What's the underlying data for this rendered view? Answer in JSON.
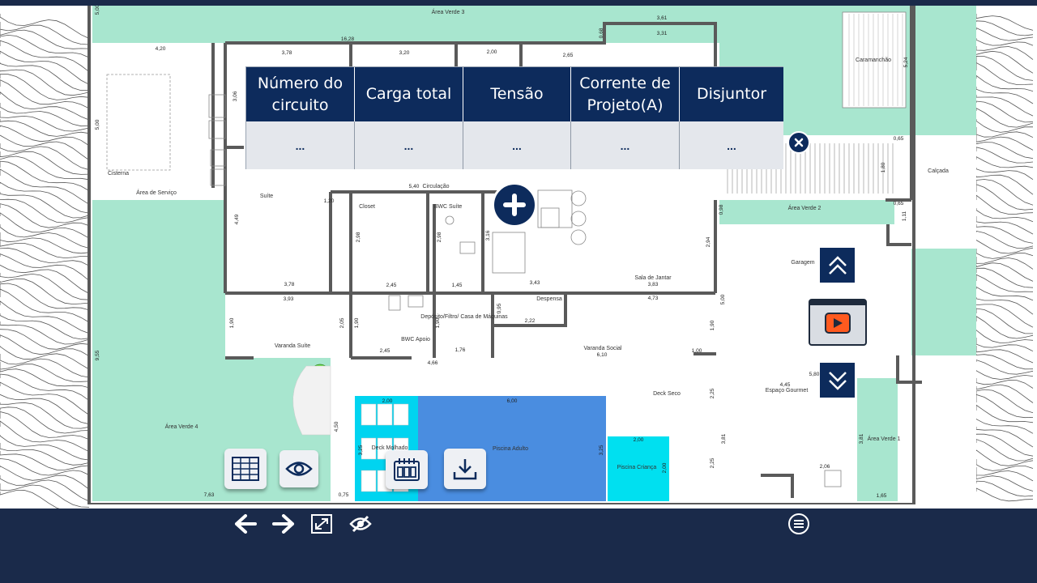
{
  "plan": {
    "rooms": {
      "area_verde_3": "Área Verde 3",
      "caramanchao": "Caramanchão",
      "cisterna": "Cisterna",
      "area_servico": "Área de Serviço",
      "suite": "Suíte",
      "circulacao": "Circulação",
      "closet": "Closet",
      "bwc_suite": "BWC Suíte",
      "calcada": "Calçada",
      "area_verde_2": "Área Verde 2",
      "garagem": "Garagem",
      "sala_jantar": "Sala de Jantar",
      "despensa": "Despensa",
      "deposito": "Depósito/Filtro/ Casa de Máquinas",
      "varanda_suite": "Varanda Suíte",
      "bwc_apoio": "BWC Apoio",
      "varanda_social": "Varanda Social",
      "deck_seco": "Deck Seco",
      "espaco_gourmet": "Espaço Gourmet",
      "area_verde_4": "Área Verde 4",
      "deck_molhado": "Deck Molhado",
      "piscina_adulto": "Piscina Adulto",
      "piscina_crianca": "Piscina Criança",
      "area_verde_1": "Área Verde 1"
    },
    "dims": {
      "d1628": "16,28",
      "d378a": "3,78",
      "d320": "3,20",
      "d200a": "2,00",
      "d265": "2,65",
      "d068": "0,68",
      "d361": "3,61",
      "d331": "3,31",
      "d420": "4,20",
      "d500a": "5,00",
      "d306": "3,06",
      "d524": "5,24",
      "d065a": "0,65",
      "d065b": "0,65",
      "d180": "1,80",
      "d111": "1,11",
      "d540": "5,40",
      "d120": "1,20",
      "d449": "4,49",
      "d298a": "2,98",
      "d298b": "2,98",
      "d316": "3,16",
      "d098": "0,98",
      "d294": "2,94",
      "d378b": "3,78",
      "d245a": "2,45",
      "d145": "1,45",
      "d343": "3,43",
      "d383": "3,83",
      "d393": "3,93",
      "d473": "4,73",
      "d095": "0,95",
      "d222": "2,22",
      "d500b": "5,00",
      "d190a": "1,90",
      "d205": "2,05",
      "d190b": "1,90",
      "d190c": "1,90",
      "d190d": "1,90",
      "d245b": "2,45",
      "d176": "1,76",
      "d610": "6,10",
      "d100": "1,00",
      "d466": "4,66",
      "d955": "9,55",
      "d225a": "2,25",
      "d445": "4,45",
      "d580": "5,80",
      "d200b": "2,00",
      "d600": "6,00",
      "d450": "4,50",
      "d325a": "3,25",
      "d325b": "3,25",
      "d200c": "2,00",
      "d200d": "2,00",
      "d381a": "3,81",
      "d225b": "2,25",
      "d381b": "3,81",
      "d763": "7,63",
      "d075": "0,75",
      "d165": "1,65",
      "d206": "2,06"
    }
  },
  "table": {
    "headers": [
      "Número do circuito",
      "Carga total",
      "Tensão",
      "Corrente de Projeto(A)",
      "Disjuntor"
    ],
    "values": [
      "...",
      "...",
      "...",
      "...",
      "..."
    ]
  },
  "colors": {
    "navy": "#0d2b5c",
    "bar": "#1a2a4a",
    "green_area": "#a8e6cf",
    "pool_adult": "#4a8de0",
    "pool_child": "#00e0f0",
    "wall": "#5a5a5a"
  },
  "icons": {
    "close": "close-icon",
    "add": "plus-icon",
    "up": "chevrons-up-icon",
    "video": "video-play-icon",
    "down": "chevrons-down-icon",
    "table": "table-icon",
    "eye": "eye-icon",
    "calendar": "calendar-icon",
    "download": "download-icon",
    "back": "arrow-left-icon",
    "forward": "arrow-right-icon",
    "fullscreen": "fullscreen-icon",
    "hide": "eye-off-icon",
    "menu": "menu-icon"
  }
}
